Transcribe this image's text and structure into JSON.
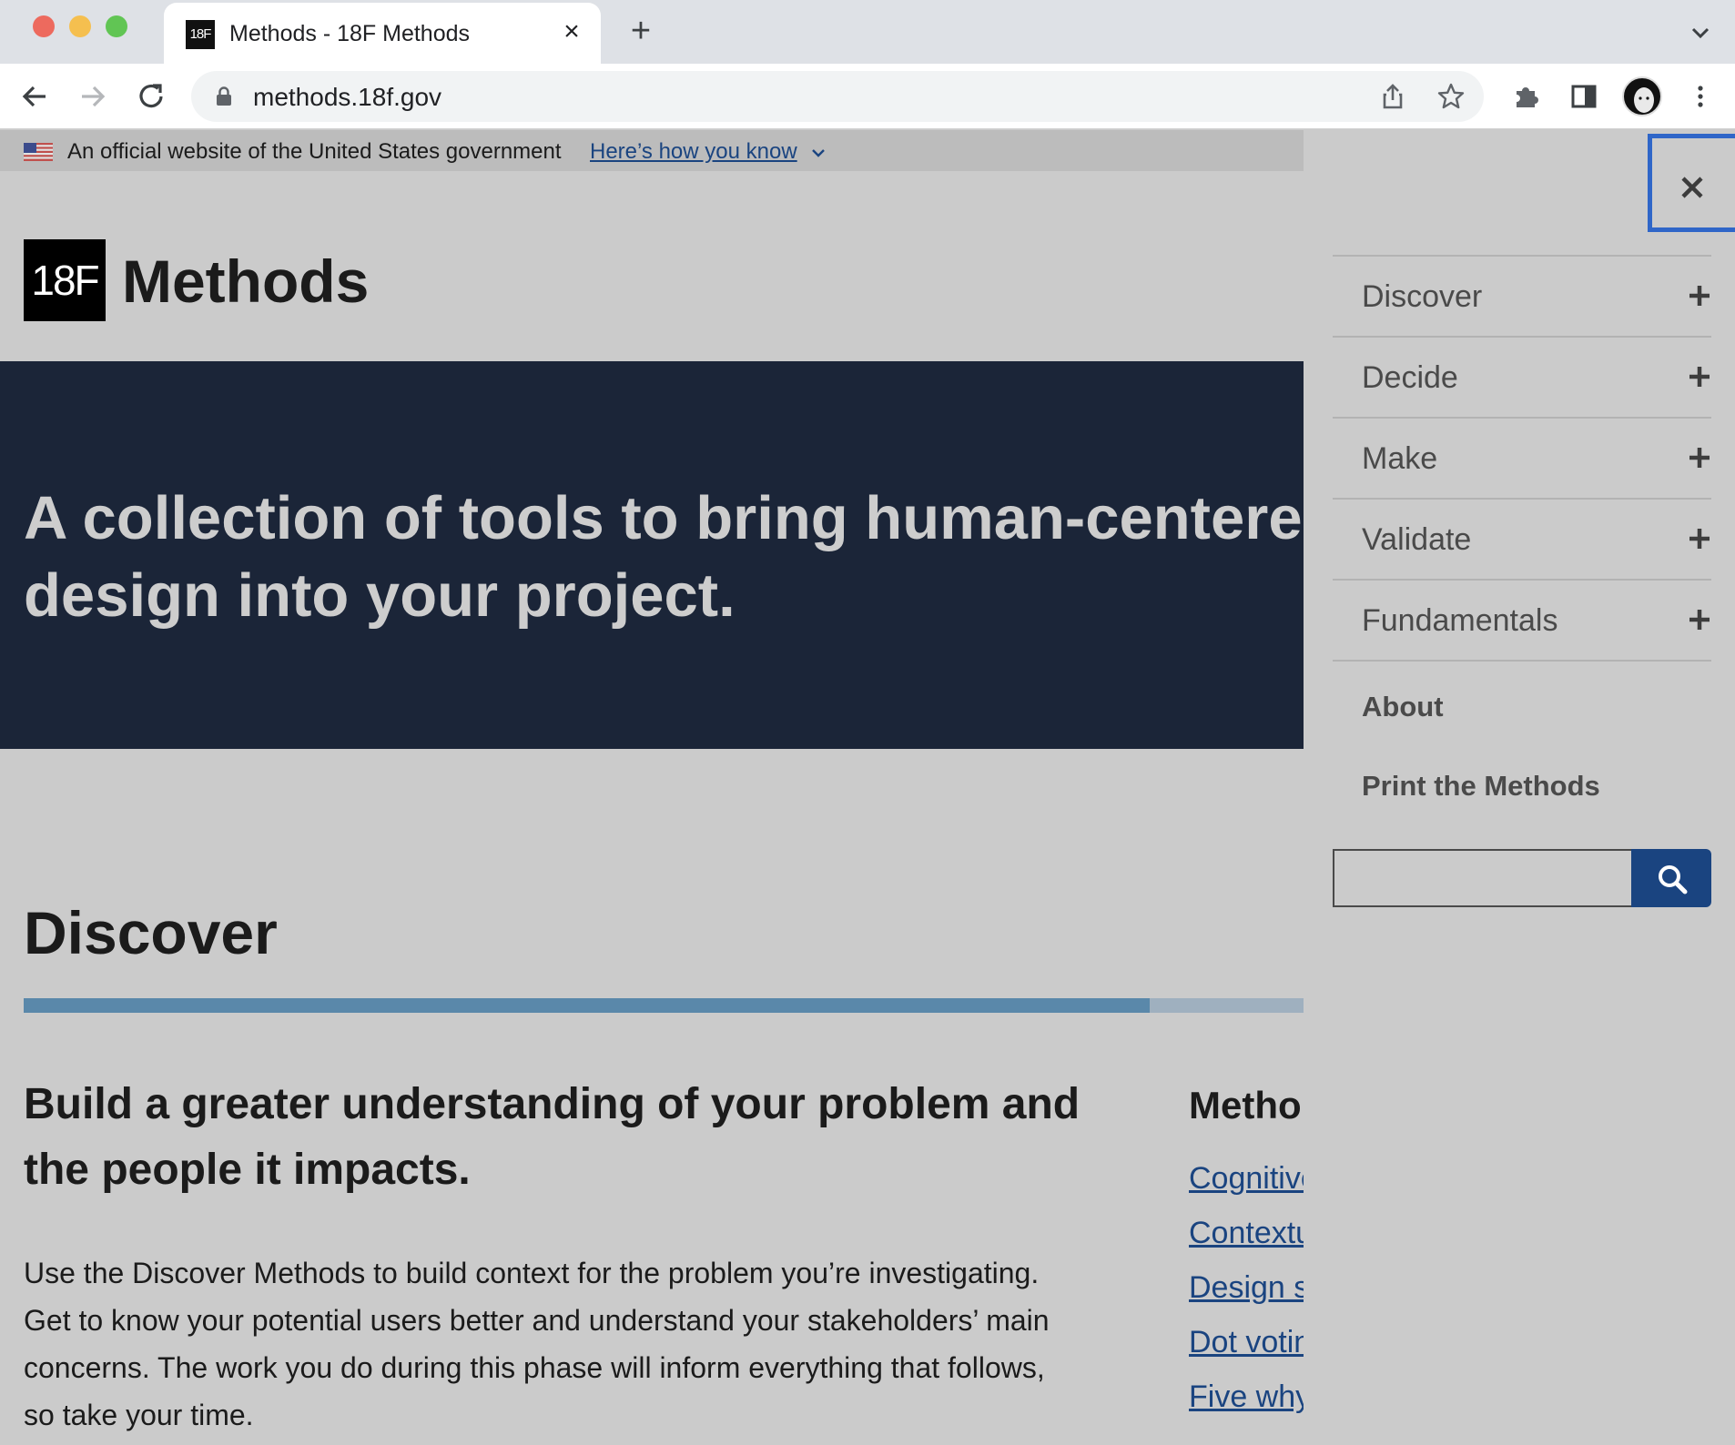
{
  "browser": {
    "tab_title": "Methods - 18F Methods",
    "tab_favicon_text": "18F",
    "url": "methods.18f.gov"
  },
  "gov_banner": {
    "text": "An official website of the United States government",
    "link": "Here’s how you know"
  },
  "header": {
    "logo_text": "18F",
    "site_title": "Methods"
  },
  "hero": {
    "text": "A collection of tools to bring human-centered design into your project."
  },
  "section": {
    "title": "Discover",
    "progress": 0.88,
    "lede": "Build a greater understanding of your problem and the people it impacts.",
    "body": "Use the Discover Methods to build context for the problem you’re investigating. Get to know your potential users better and understand your stakeholders’ main concerns. The work you do during this phase will inform everything that follows, so take your time.",
    "methods_heading": "Metho",
    "methods_links": [
      "Cognitive",
      "Contextu",
      "Design s",
      "Dot votin",
      "Five why"
    ]
  },
  "sidenav": {
    "close_icon": "close-icon",
    "items": [
      {
        "label": "Discover",
        "icon": "plus-icon"
      },
      {
        "label": "Decide",
        "icon": "plus-icon"
      },
      {
        "label": "Make",
        "icon": "plus-icon"
      },
      {
        "label": "Validate",
        "icon": "plus-icon"
      },
      {
        "label": "Fundamentals",
        "icon": "plus-icon"
      }
    ],
    "links": [
      "About",
      "Print the Methods"
    ],
    "search": {
      "value": "",
      "placeholder": "",
      "icon": "search-icon"
    }
  },
  "colors": {
    "hero_bg": "#1b2538",
    "link": "#1a4480",
    "progress_fill": "#5a88aa",
    "progress_track": "#9fb0bf",
    "focus_outline": "#2f66c8"
  }
}
